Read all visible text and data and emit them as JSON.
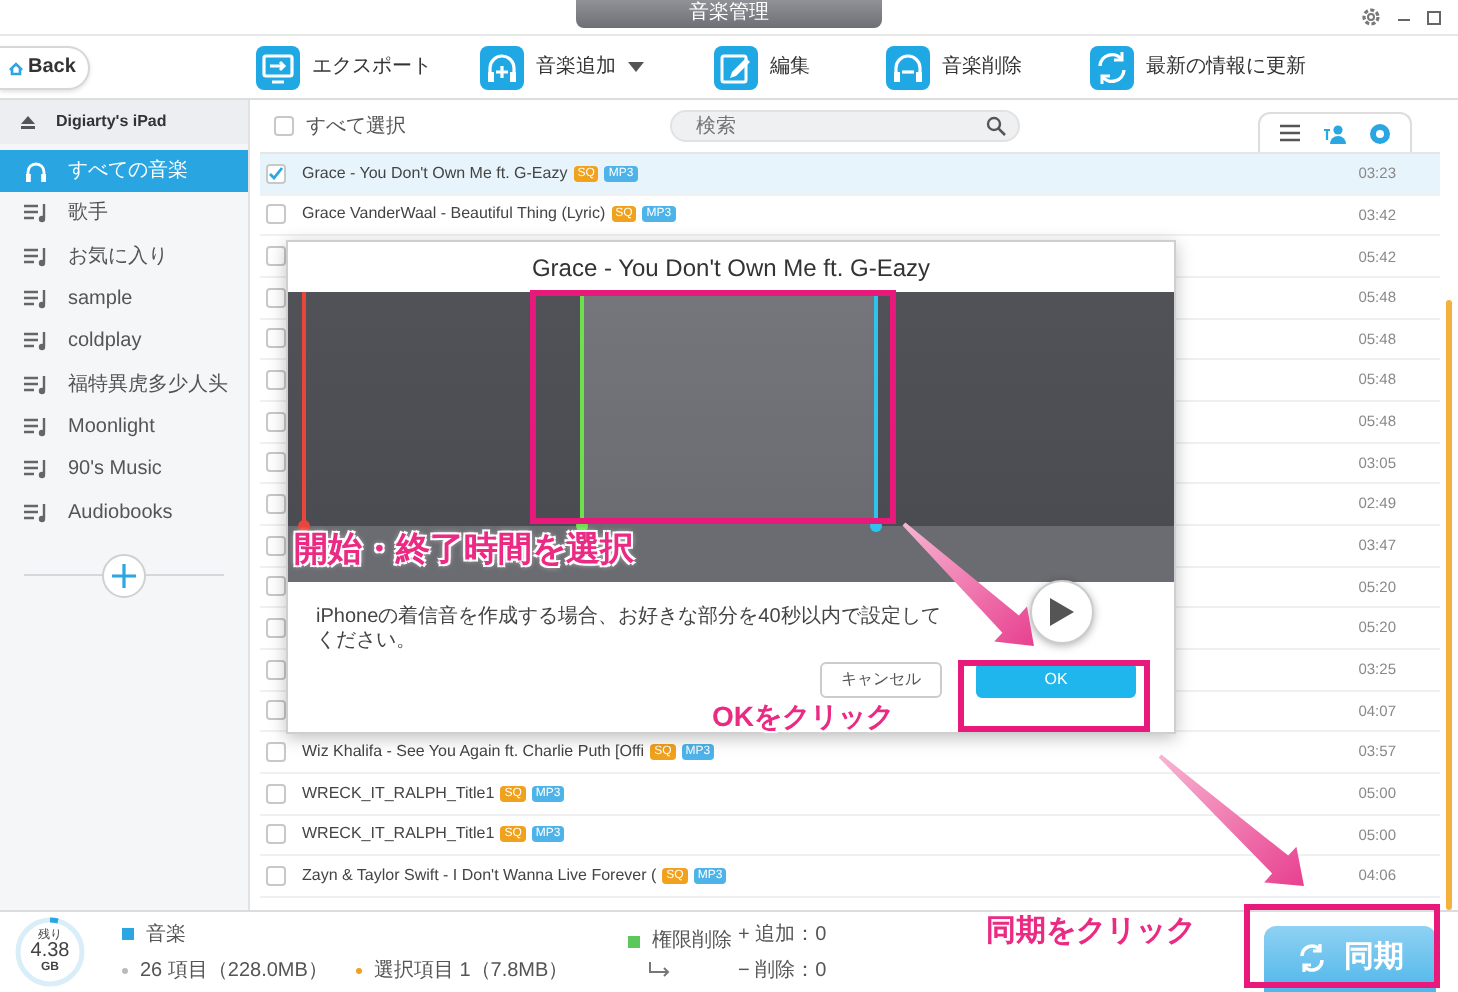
{
  "window": {
    "title": "音楽管理"
  },
  "toolbar": {
    "back": "Back",
    "actions": [
      {
        "kind": "export",
        "label": "エクスポート",
        "dropdown": false
      },
      {
        "kind": "add",
        "label": "音楽追加",
        "dropdown": true
      },
      {
        "kind": "edit",
        "label": "編集",
        "dropdown": false
      },
      {
        "kind": "delete",
        "label": "音楽削除",
        "dropdown": false
      },
      {
        "kind": "refresh",
        "label": "最新の情報に更新",
        "dropdown": false
      }
    ]
  },
  "sidebar": {
    "device": "Digiarty's iPad",
    "items": [
      {
        "kind": "all",
        "label": "すべての音楽",
        "selected": true
      },
      {
        "kind": "playlist",
        "label": "歌手",
        "selected": false
      },
      {
        "kind": "playlist",
        "label": "お気に入り",
        "selected": false
      },
      {
        "kind": "playlist",
        "label": "sample",
        "selected": false
      },
      {
        "kind": "playlist",
        "label": "coldplay",
        "selected": false
      },
      {
        "kind": "playlist",
        "label": "福特異虎多少人头",
        "selected": false
      },
      {
        "kind": "playlist",
        "label": "Moonlight",
        "selected": false
      },
      {
        "kind": "playlist",
        "label": "90's Music",
        "selected": false
      },
      {
        "kind": "playlist",
        "label": "Audiobooks",
        "selected": false
      }
    ]
  },
  "list": {
    "select_all": {
      "label": "すべて選択",
      "checked": false
    },
    "search": {
      "placeholder": "検索"
    },
    "rows": [
      {
        "title": "Grace - You Don't Own Me ft. G-Eazy",
        "quality": "SQ",
        "format": "MP3",
        "duration": "03:23",
        "checked": true,
        "selected": true
      },
      {
        "title": "Grace VanderWaal - Beautiful Thing (Lyric)",
        "quality": "SQ",
        "format": "MP3",
        "duration": "03:42",
        "checked": false,
        "selected": false
      },
      {
        "duration": "05:42",
        "checked": false,
        "selected": false
      },
      {
        "duration": "05:48",
        "checked": false,
        "selected": false
      },
      {
        "duration": "05:48",
        "checked": false,
        "selected": false
      },
      {
        "duration": "05:48",
        "checked": false,
        "selected": false
      },
      {
        "duration": "05:48",
        "checked": false,
        "selected": false
      },
      {
        "duration": "03:05",
        "checked": false,
        "selected": false
      },
      {
        "duration": "02:49",
        "checked": false,
        "selected": false
      },
      {
        "duration": "03:47",
        "checked": false,
        "selected": false
      },
      {
        "duration": "05:20",
        "checked": false,
        "selected": false
      },
      {
        "duration": "05:20",
        "checked": false,
        "selected": false
      },
      {
        "duration": "03:25",
        "checked": false,
        "selected": false
      },
      {
        "duration": "04:07",
        "checked": false,
        "selected": false
      },
      {
        "title": "Wiz Khalifa - See You Again ft. Charlie Puth [Offi",
        "quality": "SQ",
        "format": "MP3",
        "duration": "03:57",
        "checked": false,
        "selected": false
      },
      {
        "title": "WRECK_IT_RALPH_Title1",
        "quality": "SQ",
        "format": "MP3",
        "duration": "05:00",
        "checked": false,
        "selected": false
      },
      {
        "title": "WRECK_IT_RALPH_Title1",
        "quality": "SQ",
        "format": "MP3",
        "duration": "05:00",
        "checked": false,
        "selected": false
      },
      {
        "title": "Zayn & Taylor Swift - I Don't Wanna Live Forever (",
        "quality": "SQ",
        "format": "MP3",
        "duration": "04:06",
        "checked": false,
        "selected": false
      }
    ]
  },
  "dialog": {
    "title": "Grace - You Don't Own Me ft. G-Eazy",
    "message": "iPhoneの着信音を作成する場合、お好きな部分を40秒以内で設定してください。",
    "buttons": [
      {
        "kind": "secondary",
        "label": "キャンセル"
      },
      {
        "kind": "primary",
        "label": "OK"
      }
    ]
  },
  "callouts": [
    {
      "text": "開始・終了時間を選択"
    },
    {
      "text": "OKをクリック"
    },
    {
      "text": "同期をクリック"
    }
  ],
  "status_bar": {
    "storage": {
      "label": "残り",
      "value": "4.38",
      "unit": "GB"
    },
    "category": "音楽",
    "total": "26 項目（228.0MB）",
    "selection": "選択項目 1（7.8MB）",
    "permission": "権限削除",
    "added": "+ 追加：0",
    "deleted": "− 削除：0",
    "sync": "同期"
  }
}
